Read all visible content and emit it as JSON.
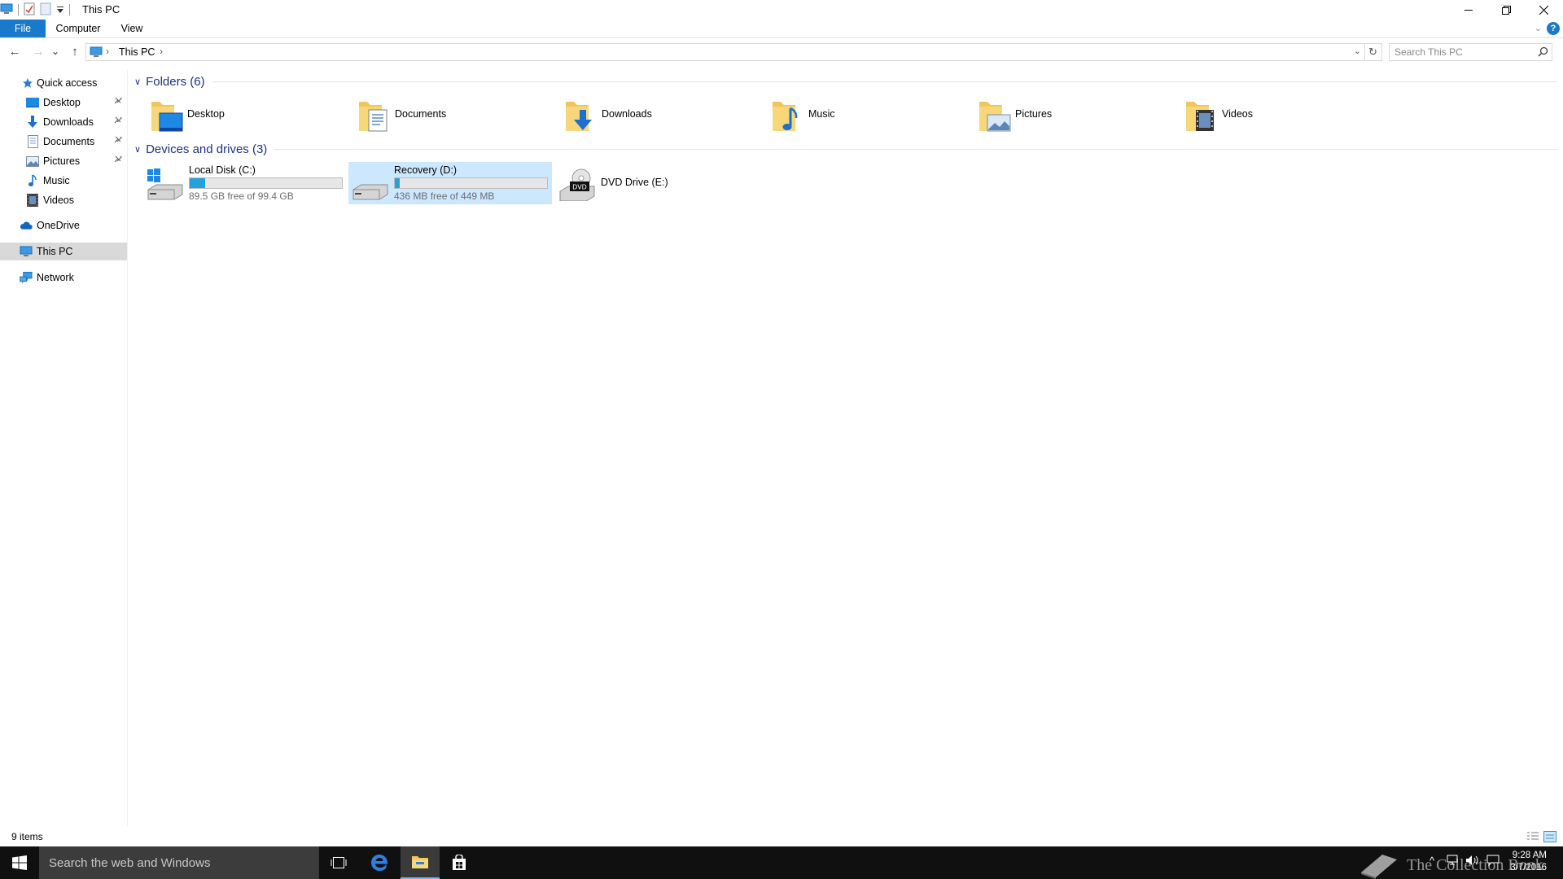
{
  "window": {
    "title": "This PC",
    "quick_access_toolbar": [
      "pc-icon",
      "properties-icon",
      "new-folder-icon",
      "customize-qat-icon"
    ],
    "controls": {
      "minimize": "minimize-icon",
      "restore": "restore-icon",
      "close": "close-icon"
    }
  },
  "ribbon": {
    "tabs": [
      {
        "label": "File",
        "active": true
      },
      {
        "label": "Computer"
      },
      {
        "label": "View"
      }
    ],
    "help": "?",
    "accent_color": "#1979ca"
  },
  "navbar": {
    "back": "←",
    "forward": "→",
    "recent": "⌄",
    "up": "↑",
    "breadcrumb": [
      "This PC"
    ],
    "refresh": "↻",
    "search_placeholder": "Search This PC"
  },
  "navpane": {
    "quick_access": {
      "label": "Quick access",
      "items": [
        {
          "label": "Desktop",
          "pinned": true
        },
        {
          "label": "Downloads",
          "pinned": true
        },
        {
          "label": "Documents",
          "pinned": true
        },
        {
          "label": "Pictures",
          "pinned": true
        },
        {
          "label": "Music",
          "pinned": false
        },
        {
          "label": "Videos",
          "pinned": false
        }
      ]
    },
    "onedrive": "OneDrive",
    "this_pc": "This PC",
    "network": "Network"
  },
  "content": {
    "folders_header": "Folders (6)",
    "folders": [
      {
        "label": "Desktop",
        "icon": "desktop-folder-icon"
      },
      {
        "label": "Documents",
        "icon": "documents-folder-icon"
      },
      {
        "label": "Downloads",
        "icon": "downloads-folder-icon"
      },
      {
        "label": "Music",
        "icon": "music-folder-icon"
      },
      {
        "label": "Pictures",
        "icon": "pictures-folder-icon"
      },
      {
        "label": "Videos",
        "icon": "videos-folder-icon"
      }
    ],
    "drives_header": "Devices and drives (3)",
    "drives": [
      {
        "name": "Local Disk (C:)",
        "free_text": "89.5 GB free of 99.4 GB",
        "used_fraction": 0.1,
        "selected": false
      },
      {
        "name": "Recovery (D:)",
        "free_text": "436 MB free of 449 MB",
        "used_fraction": 0.03,
        "selected": true
      },
      {
        "name": "DVD Drive (E:)",
        "free_text": "",
        "selected": false
      }
    ],
    "drive_bar_color": "#26a0da",
    "header_color": "#1e3287"
  },
  "statusbar": {
    "item_count": "9 items"
  },
  "taskbar": {
    "search_placeholder": "Search the web and Windows",
    "watermark": "The Collection Book",
    "clock_time": "9:28 AM",
    "clock_date": "3/7/2016",
    "tray_overflow": "^"
  }
}
